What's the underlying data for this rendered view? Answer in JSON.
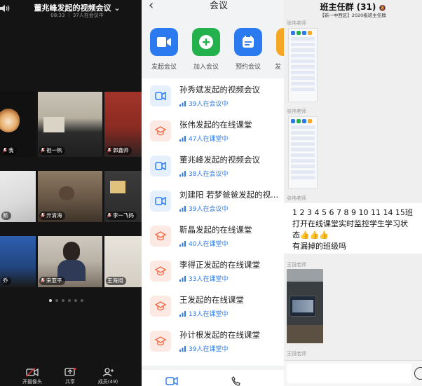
{
  "meeting": {
    "title": "董兆峰发起的视频会议",
    "subtitle": "08:33 ｜ 37人在会议中",
    "participants": [
      "我",
      "祖一帆",
      "郭鑫帅",
      "新",
      "亓清海",
      "李一飞妈",
      "乔",
      "宋亚平",
      "王海阔"
    ],
    "page_count": 6,
    "active_page": 1,
    "toolbar": [
      "开摄像头",
      "共享",
      "成员(49)"
    ]
  },
  "meeting_list": {
    "title": "会议",
    "back_icon": "chevron-left-icon",
    "quick_actions": [
      {
        "label": "发起会议",
        "icon": "video-camera-icon",
        "color": "#2b7af0"
      },
      {
        "label": "加入会议",
        "icon": "plus-circle-icon",
        "color": "#22b14c"
      },
      {
        "label": "预约会议",
        "icon": "calendar-icon",
        "color": "#2b7af0"
      },
      {
        "label": "发",
        "icon": "share-icon",
        "color": "#f5a623"
      }
    ],
    "items": [
      {
        "title": "孙秀斌发起的视频会议",
        "count": "39人在会议中",
        "type": "meeting"
      },
      {
        "title": "张伟发起的在线课堂",
        "count": "47人在课堂中",
        "type": "class"
      },
      {
        "title": "董兆峰发起的视频会议",
        "count": "38人在会议中",
        "type": "meeting"
      },
      {
        "title": "刘建阳 若梦爸爸发起的视...",
        "count": "39人在会议中",
        "type": "meeting"
      },
      {
        "title": "靳晶发起的在线课堂",
        "count": "40人在课堂中",
        "type": "class"
      },
      {
        "title": "李得正发起的在线课堂",
        "count": "33人在课堂中",
        "type": "class"
      },
      {
        "title": "王发起的在线课堂",
        "count": "13人在课堂中",
        "type": "class"
      },
      {
        "title": "孙计根发起的在线课堂",
        "count": "39人在课堂中",
        "type": "class"
      }
    ],
    "colors": {
      "meeting_bg": "#e6f0fc",
      "meeting_fg": "#2b7af0",
      "class_bg": "#fde9e4",
      "class_fg": "#f06a45",
      "count_text": "#2a7ae4"
    }
  },
  "chat": {
    "title": "班主任群 (31)",
    "subtitle": "【新一中西区】2020级班主任群",
    "sender_a": "张伟老师",
    "message_lines": [
      "1 2 3 4 5 6 7 8 9 10 11 14 15班",
      "打开在线课堂实时监控学生学习状",
      "态👍👍👍",
      "有漏掉的班级吗"
    ],
    "sender_b": "王锐老师"
  }
}
